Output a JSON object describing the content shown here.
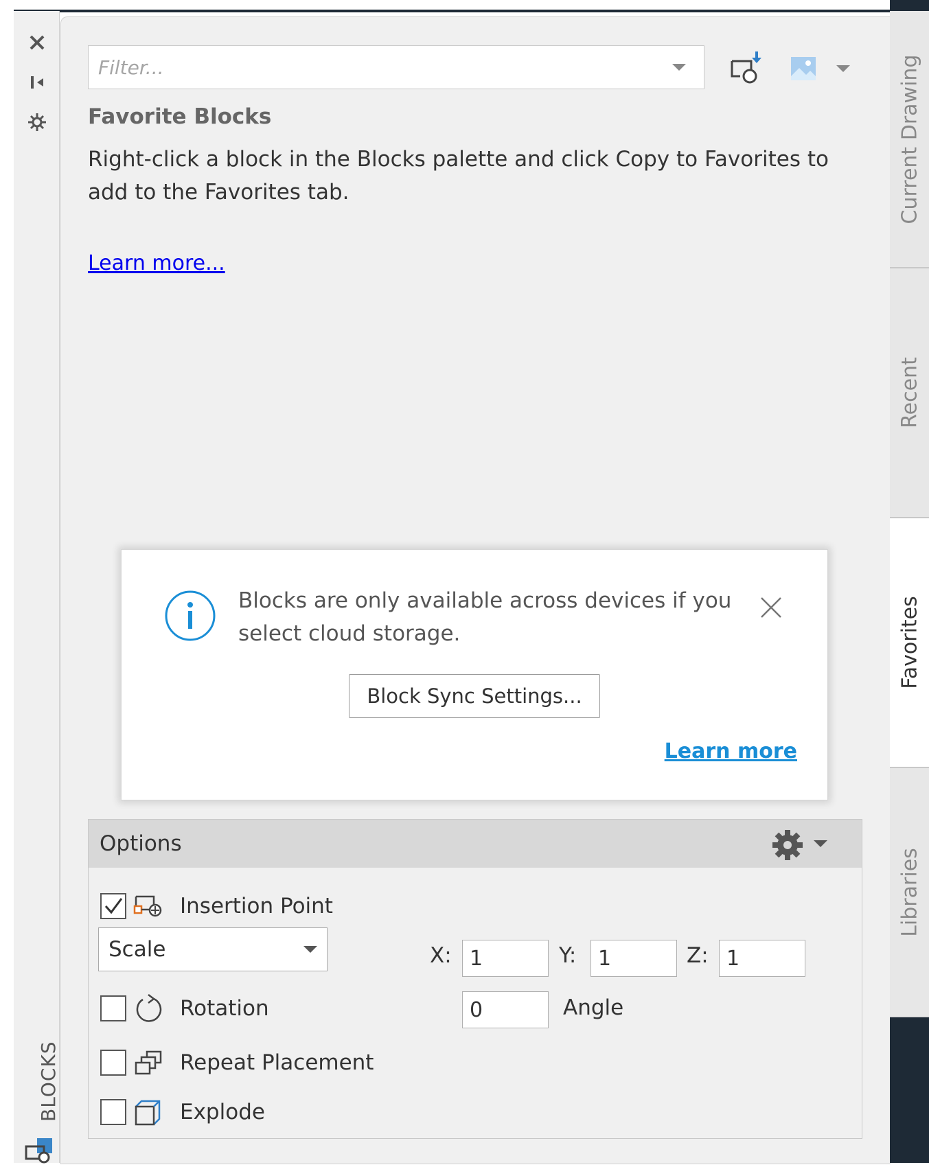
{
  "left_bar": {
    "label": "BLOCKS"
  },
  "filter": {
    "placeholder": "Filter..."
  },
  "favorites": {
    "title": "Favorite Blocks",
    "description": "Right-click a block in the Blocks palette and click Copy to Favorites to add to the Favorites tab.",
    "learn_more": "Learn more..."
  },
  "popup": {
    "message": "Blocks are only available across devices if you select cloud storage.",
    "button": "Block Sync Settings...",
    "learn_more": "Learn more"
  },
  "options": {
    "title": "Options",
    "insertion_point": {
      "label": "Insertion Point",
      "checked": true
    },
    "scale": {
      "selected": "Scale",
      "checked": false,
      "x_label": "X:",
      "x": "1",
      "y_label": "Y:",
      "y": "1",
      "z_label": "Z:",
      "z": "1"
    },
    "rotation": {
      "label": "Rotation",
      "checked": false,
      "value": "0",
      "unit_label": "Angle"
    },
    "repeat_placement": {
      "label": "Repeat Placement",
      "checked": false
    },
    "explode": {
      "label": "Explode",
      "checked": false
    }
  },
  "tabs": [
    {
      "label": "Current Drawing",
      "active": false
    },
    {
      "label": "Recent",
      "active": false
    },
    {
      "label": "Favorites",
      "active": true
    },
    {
      "label": "Libraries",
      "active": false
    }
  ],
  "colors": {
    "link": "#0000ee",
    "accent": "#1a8ed6",
    "dark_frame": "#1e2a36"
  }
}
